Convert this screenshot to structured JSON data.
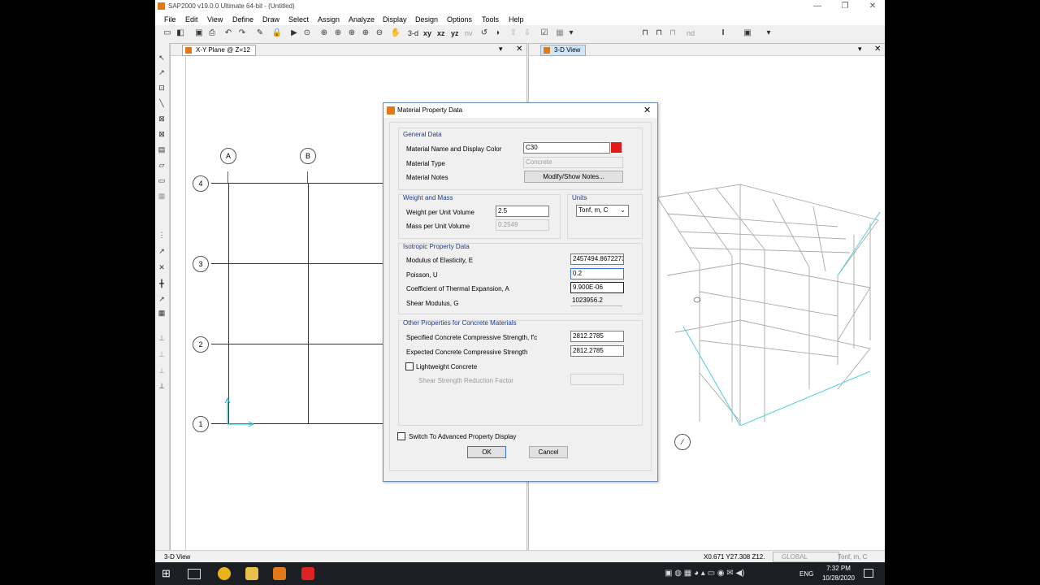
{
  "app": {
    "title": "SAP2000 v19.0.0 Ultimate 64-bit - (Untitled)",
    "window_buttons": [
      "—",
      "❐",
      "✕"
    ]
  },
  "menu": [
    "File",
    "Edit",
    "View",
    "Define",
    "Draw",
    "Select",
    "Assign",
    "Analyze",
    "Display",
    "Design",
    "Options",
    "Tools",
    "Help"
  ],
  "toolbar": {
    "view_buttons": [
      "3-d",
      "xy",
      "xz",
      "yz",
      "nv"
    ],
    "nd_label": "nd"
  },
  "left_panel": {
    "tab_title": "X-Y Plane @ Z=12",
    "grid_x_labels": [
      "A",
      "B"
    ],
    "grid_y_labels": [
      "4",
      "3",
      "2",
      "1"
    ]
  },
  "right_panel": {
    "tab_title": "3-D View",
    "bubble": "⁄"
  },
  "dialog": {
    "title": "Material Property Data",
    "general": {
      "title": "General Data",
      "name_label": "Material Name and Display Color",
      "name_value": "C30",
      "color": "#e31a1a",
      "type_label": "Material Type",
      "type_value": "Concrete",
      "notes_label": "Material Notes",
      "notes_button": "Modify/Show Notes..."
    },
    "weight": {
      "title": "Weight and Mass",
      "wpuv_label": "Weight per Unit Volume",
      "wpuv_value": "2.5",
      "mpuv_label": "Mass per Unit Volume",
      "mpuv_value": "0.2549"
    },
    "units": {
      "title": "Units",
      "value": "Tonf, m, C"
    },
    "isotropic": {
      "title": "Isotropic Property Data",
      "e_label": "Modulus of Elasticity,  E",
      "e_value": "2457494.8672273",
      "u_label": "Poisson,  U",
      "u_value": "0.2",
      "a_label": "Coefficient of Thermal Expansion,  A",
      "a_value": "9.900E-06",
      "g_label": "Shear Modulus,  G",
      "g_value": "1023956.2"
    },
    "concrete": {
      "title": "Other Properties for Concrete Materials",
      "fc_label": "Specified Concrete Compressive Strength,  f'c",
      "fc_value": "2812.2785",
      "efc_label": "Expected Concrete Compressive Strength",
      "efc_value": "2812.2785",
      "lw_label": "Lightweight Concrete",
      "ssrf_label": "Shear Strength Reduction Factor"
    },
    "advanced_label": "Switch To Advanced Property Display",
    "ok": "OK",
    "cancel": "Cancel"
  },
  "status": {
    "left": "3-D View",
    "coords": "X0.671  Y27.308  Z12.",
    "system": "GLOBAL",
    "units": "Tonf, m, C"
  },
  "taskbar": {
    "lang": "ENG",
    "time": "7:32 PM",
    "date": "10/28/2020"
  }
}
